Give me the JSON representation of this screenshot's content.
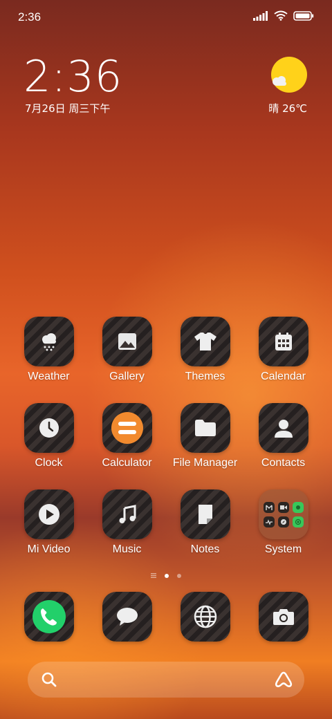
{
  "status_bar": {
    "time": "2:36"
  },
  "clock_widget": {
    "time": "2:36",
    "date": "7月26日 周三下午"
  },
  "weather_widget": {
    "text": "晴 26℃"
  },
  "apps": [
    {
      "label": "Weather"
    },
    {
      "label": "Gallery"
    },
    {
      "label": "Themes"
    },
    {
      "label": "Calendar"
    },
    {
      "label": "Clock"
    },
    {
      "label": "Calculator"
    },
    {
      "label": "File Manager"
    },
    {
      "label": "Contacts"
    },
    {
      "label": "Mi Video"
    },
    {
      "label": "Music"
    },
    {
      "label": "Notes"
    },
    {
      "label": "System"
    }
  ],
  "dock": [
    "phone-icon",
    "messages-icon",
    "browser-icon",
    "camera-icon"
  ],
  "colors": {
    "accent_calculator": "#f28a2e",
    "phone_green": "#22d06a",
    "sun_yellow": "#ffd21a"
  }
}
